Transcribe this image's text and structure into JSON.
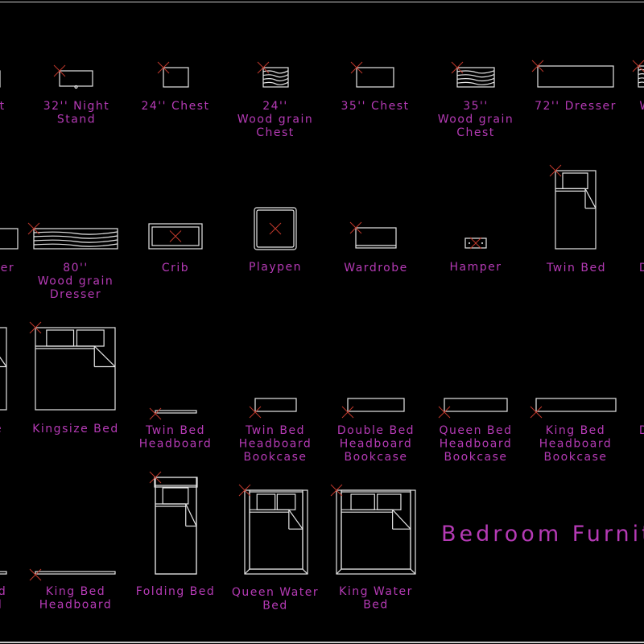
{
  "drawing": {
    "title": "Bedroom Furniture",
    "colors": {
      "background": "#000000",
      "linework": "#e6e6e6",
      "text": "#b53ab5",
      "insertion_marker": "#c0392b"
    }
  },
  "items": [
    {
      "id": "night-stand-partial",
      "symbol": "rect",
      "label": [
        "nt"
      ]
    },
    {
      "id": "night-stand-32",
      "symbol": "nightstand",
      "label": [
        "32'' Night",
        "Stand"
      ]
    },
    {
      "id": "chest-24",
      "symbol": "rect",
      "label": [
        "24'' Chest"
      ]
    },
    {
      "id": "wood-grain-chest-24",
      "symbol": "woodgrain",
      "label": [
        "24''",
        "Wood grain",
        "Chest"
      ]
    },
    {
      "id": "chest-35",
      "symbol": "rect",
      "label": [
        "35'' Chest"
      ]
    },
    {
      "id": "wood-grain-chest-35",
      "symbol": "woodgrain",
      "label": [
        "35''",
        "Wood grain",
        "Chest"
      ]
    },
    {
      "id": "dresser-72",
      "symbol": "rect",
      "label": [
        "72'' Dresser"
      ]
    },
    {
      "id": "wood-grain-partial",
      "symbol": "woodgrain",
      "label": [
        "W"
      ]
    },
    {
      "id": "dresser-partial",
      "symbol": "rect",
      "label": [
        "ser"
      ]
    },
    {
      "id": "wood-grain-dresser-80",
      "symbol": "woodgrain",
      "label": [
        "80''",
        "Wood grain",
        "Dresser"
      ]
    },
    {
      "id": "crib",
      "symbol": "crib",
      "label": [
        "Crib"
      ]
    },
    {
      "id": "playpen",
      "symbol": "playpen",
      "label": [
        "Playpen"
      ]
    },
    {
      "id": "wardrobe",
      "symbol": "wardrobe",
      "label": [
        "Wardrobe"
      ]
    },
    {
      "id": "hamper",
      "symbol": "hamper",
      "label": [
        "Hamper"
      ]
    },
    {
      "id": "twin-bed",
      "symbol": "bed1",
      "label": [
        "Twin Bed"
      ]
    },
    {
      "id": "double-bed-partial",
      "symbol": "none",
      "label": [
        "D"
      ]
    },
    {
      "id": "queensize-bed-partial",
      "symbol": "bed-partial",
      "label": [
        "e"
      ]
    },
    {
      "id": "kingsize-bed",
      "symbol": "bed2",
      "label": [
        "Kingsize Bed"
      ]
    },
    {
      "id": "twin-bed-headboard",
      "symbol": "headboard",
      "label": [
        "Twin Bed",
        "Headboard"
      ]
    },
    {
      "id": "twin-bed-headboard-bookcase",
      "symbol": "bookcase",
      "label": [
        "Twin Bed",
        "Headboard",
        "Bookcase"
      ]
    },
    {
      "id": "double-bed-headboard-bookcase",
      "symbol": "bookcase",
      "label": [
        "Double Bed",
        "Headboard",
        "Bookcase"
      ]
    },
    {
      "id": "queen-bed-headboard-bookcase",
      "symbol": "bookcase",
      "label": [
        "Queen Bed",
        "Headboard",
        "Bookcase"
      ]
    },
    {
      "id": "king-bed-headboard-bookcase",
      "symbol": "bookcase",
      "label": [
        "King Bed",
        "Headboard",
        "Bookcase"
      ]
    },
    {
      "id": "headboard-bookcase-partial",
      "symbol": "none",
      "label": [
        "D"
      ]
    },
    {
      "id": "headboard-partial",
      "symbol": "headboard",
      "label": [
        "ed",
        "d"
      ]
    },
    {
      "id": "king-bed-headboard",
      "symbol": "headboard",
      "label": [
        "King Bed",
        "Headboard"
      ]
    },
    {
      "id": "folding-bed",
      "symbol": "folding",
      "label": [
        "Folding Bed"
      ]
    },
    {
      "id": "queen-water-bed",
      "symbol": "water",
      "label": [
        "Queen Water",
        "Bed"
      ]
    },
    {
      "id": "king-water-bed",
      "symbol": "water",
      "label": [
        "King Water",
        "Bed"
      ]
    }
  ]
}
